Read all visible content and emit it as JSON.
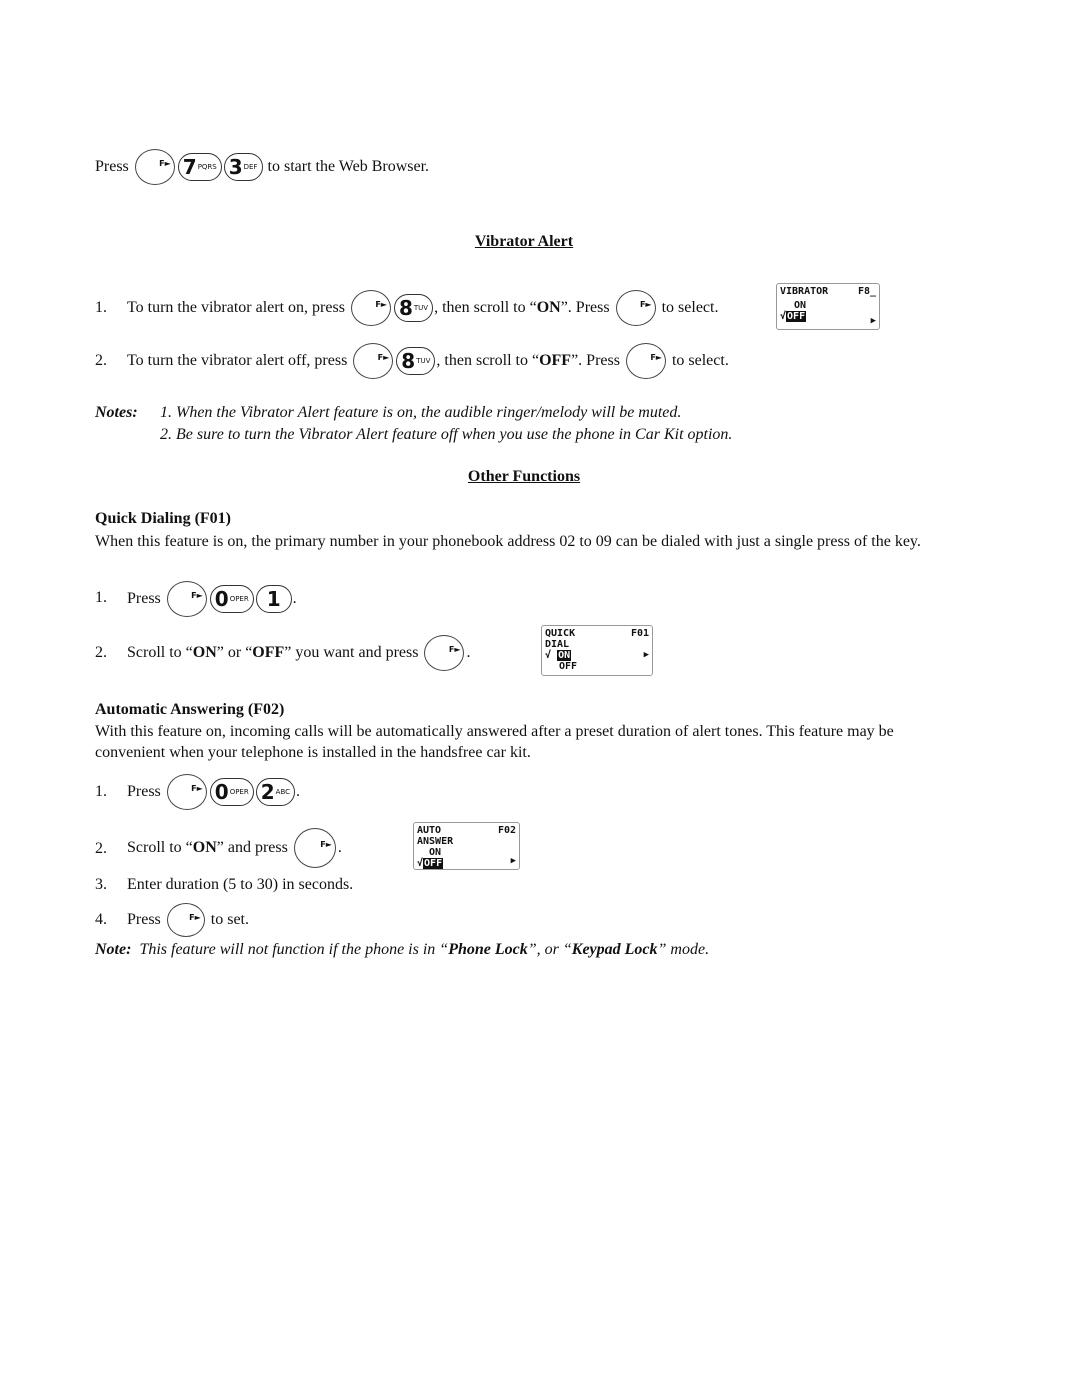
{
  "keys": {
    "f": "F►",
    "k7": {
      "d": "7",
      "l": "PQRS"
    },
    "k3": {
      "d": "3",
      "l": "DEF"
    },
    "k8": {
      "d": "8",
      "l": "TUV"
    },
    "k0": {
      "d": "0",
      "l": "OPER"
    },
    "k1": {
      "d": "1",
      "l": ""
    },
    "k2": {
      "d": "2",
      "l": "ABC"
    }
  },
  "intro": {
    "press": "Press",
    "rest": "to start the Web Browser."
  },
  "vibrator": {
    "title": "Vibrator Alert",
    "items": [
      {
        "n": "1.",
        "a": "To turn the vibrator alert on, press",
        "b": ", then scroll to “",
        "bold": "ON",
        "c": "”.  Press",
        "d": "to select."
      },
      {
        "n": "2.",
        "a": "To turn the vibrator alert off, press",
        "b": ", then scroll to “",
        "bold": "OFF",
        "c": "”.  Press",
        "d": "to select."
      }
    ],
    "screen": {
      "title": "VIBRATOR",
      "code": "F8_",
      "opt1": "ON",
      "opt2": "OFF",
      "check": "√"
    },
    "notes_label": "Notes:",
    "notes": [
      "1.  When the Vibrator Alert feature is on, the audible ringer/melody will be muted.",
      "2.  Be sure to turn the Vibrator Alert feature off when you use the phone in Car Kit option."
    ]
  },
  "other": {
    "title": "Other Functions"
  },
  "quick": {
    "heading": "Quick Dialing (F01)",
    "text": "When this feature is on, the primary number in your phonebook address 02 to 09 can be dialed with just a single press of the key.",
    "s1": {
      "n": "1.",
      "a": "Press",
      "end": "."
    },
    "s2": {
      "n": "2.",
      "a": "Scroll to “",
      "b1": "ON",
      "a2": "” or “",
      "b2": "OFF",
      "a3": "” you want and press",
      "end": "."
    },
    "screen": {
      "l1": "QUICK",
      "code": "F01",
      "l2": "DIAL",
      "opt1": "ON",
      "opt2": "OFF",
      "check": "√"
    }
  },
  "auto": {
    "heading": "Automatic Answering (F02)",
    "text": "With this feature on, incoming calls will be automatically answered after a preset duration of alert tones.  This feature may be convenient when your telephone is installed in the handsfree car kit.",
    "s1": {
      "n": "1.",
      "a": "Press",
      "end": "."
    },
    "s2": {
      "n": "2.",
      "a": "Scroll to “",
      "b": "ON",
      "a2": "” and press",
      "end": "."
    },
    "s3": {
      "n": "3.",
      "a": "Enter duration (5 to 30) in seconds."
    },
    "s4": {
      "n": "4.",
      "a": "Press",
      "b": "to set."
    },
    "screen": {
      "l1": "AUTO",
      "code": "F02",
      "l2": "ANSWER",
      "opt1": "ON",
      "opt2": "OFF",
      "check": "√"
    },
    "note": {
      "label": "Note:",
      "a": "  This feature will not function if the phone is in “",
      "b1": "Phone Lock",
      "a2": "”, or “",
      "b2": "Keypad Lock",
      "a3": "” mode."
    }
  }
}
